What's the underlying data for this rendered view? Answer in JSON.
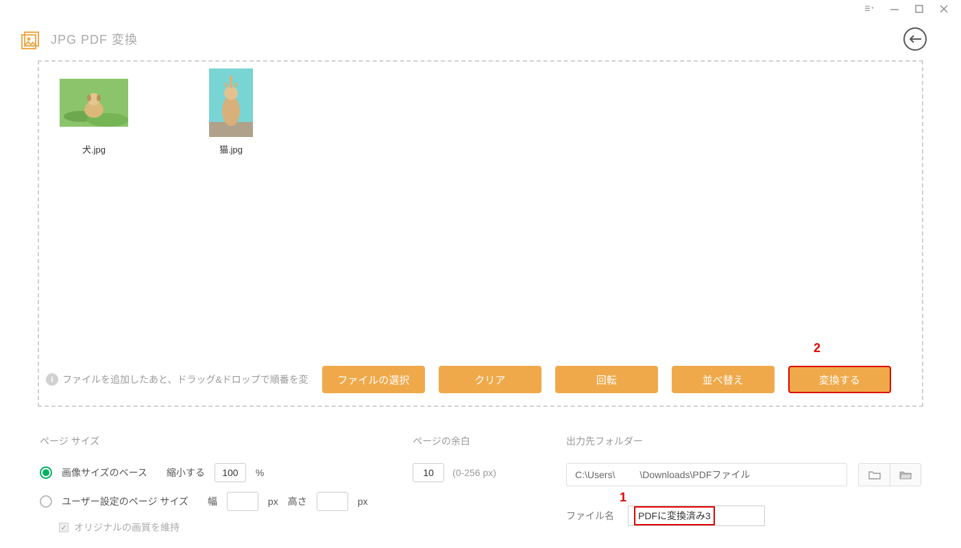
{
  "app": {
    "title": "JPG PDF 変換"
  },
  "thumbs": [
    {
      "label": "犬.jpg"
    },
    {
      "label": "猫.jpg"
    }
  ],
  "info_note": "ファイルを追加したあと、ドラッグ&ドロップで順番を変",
  "buttons": {
    "select": "ファイルの選択",
    "clear": "クリア",
    "rotate": "回転",
    "sort": "並べ替え",
    "convert": "変換する"
  },
  "annotations": {
    "a1": "1",
    "a2": "2"
  },
  "page_size": {
    "title": "ページ サイズ",
    "opt_image": "画像サイズのベース",
    "shrink_label": "縮小する",
    "shrink_value": "100",
    "pct": "%",
    "opt_user": "ユーザー設定のページ サイズ",
    "width_label": "幅",
    "height_label": "高さ",
    "px": "px",
    "keep_quality": "オリジナルの画質を維持"
  },
  "margin": {
    "title": "ページの余白",
    "value": "10",
    "range": "(0-256 px)"
  },
  "output": {
    "title": "出力先フォルダー",
    "path_prefix": "C:\\Users\\",
    "path_suffix": "\\Downloads\\PDFファイル",
    "filename_label": "ファイル名",
    "filename_value": "PDFに変換済み3"
  }
}
